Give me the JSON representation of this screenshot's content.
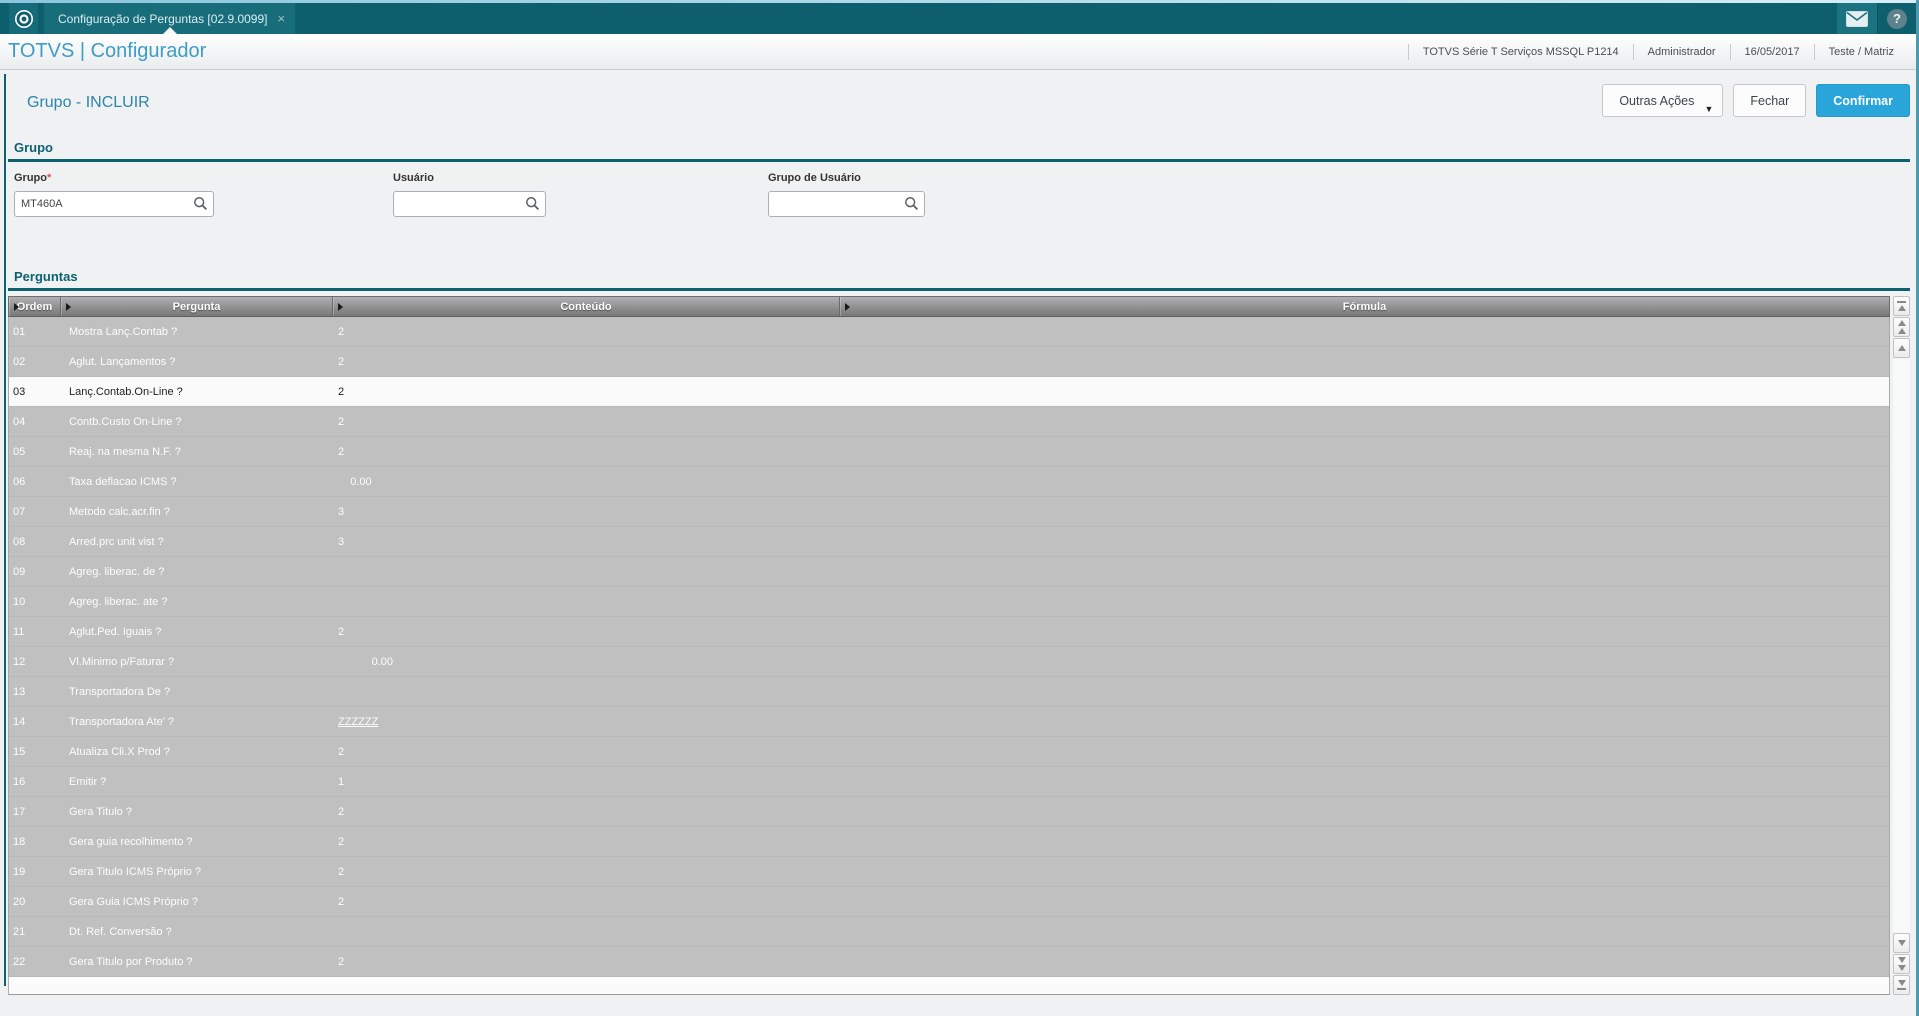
{
  "colors": {
    "accent_teal": "#0d6270",
    "titlebar_teal": "#0e5f6d",
    "tab_teal": "#176d7a",
    "confirm_blue": "#29a5da",
    "app_title_blue": "#3f9cc9",
    "page_title_blue": "#2d84ad",
    "grid_row_gray": "#c0c0c0",
    "grid_selected_row": "#fafafa"
  },
  "titlebar": {
    "tab_label": "Configuração de Perguntas [02.9.0099]",
    "close_glyph": "×",
    "help_glyph": "?"
  },
  "appbar": {
    "title": "TOTVS | Configurador",
    "info": [
      "TOTVS Série T Serviços MSSQL P1214",
      "Administrador",
      "16/05/2017",
      "Teste / Matriz"
    ]
  },
  "toolbar": {
    "page_title": "Grupo - INCLUIR",
    "other_actions_label": "Outras Ações",
    "other_actions_caret": "▼",
    "close_label": "Fechar",
    "confirm_label": "Confirmar"
  },
  "grupo": {
    "legend": "Grupo",
    "fields": [
      {
        "label": "Grupo",
        "required": "*",
        "value": "MT460A",
        "placeholder": ""
      },
      {
        "label": "Usuário",
        "required": "",
        "value": "",
        "placeholder": ""
      },
      {
        "label": "Grupo de Usuário",
        "required": "",
        "value": "",
        "placeholder": ""
      }
    ]
  },
  "perguntas": {
    "legend": "Perguntas",
    "table": {
      "columns": [
        "Ordem",
        "Pergunta",
        "Conteúdo",
        "Fórmula"
      ],
      "rows": [
        {
          "ordem": "01",
          "pergunta": "Mostra Lanç.Contab ?",
          "conteudo": "2",
          "formula": ""
        },
        {
          "ordem": "02",
          "pergunta": "Aglut. Lançamentos ?",
          "conteudo": "2",
          "formula": ""
        },
        {
          "ordem": "03",
          "pergunta": "Lanç.Contab.On-Line ?",
          "conteudo": "2",
          "formula": "",
          "selected": true
        },
        {
          "ordem": "04",
          "pergunta": "Contb.Custo On-Line ?",
          "conteudo": "2",
          "formula": ""
        },
        {
          "ordem": "05",
          "pergunta": "Reaj. na mesma N.F. ?",
          "conteudo": "2",
          "formula": ""
        },
        {
          "ordem": "06",
          "pergunta": "Taxa deflacao ICMS ?",
          "conteudo": "    0.00",
          "formula": ""
        },
        {
          "ordem": "07",
          "pergunta": "Metodo calc.acr.fin ?",
          "conteudo": "3",
          "formula": ""
        },
        {
          "ordem": "08",
          "pergunta": "Arred.prc unit vist ?",
          "conteudo": "3",
          "formula": ""
        },
        {
          "ordem": "09",
          "pergunta": "Agreg. liberac. de ?",
          "conteudo": "",
          "formula": ""
        },
        {
          "ordem": "10",
          "pergunta": "Agreg. liberac. ate ?",
          "conteudo": "",
          "formula": ""
        },
        {
          "ordem": "11",
          "pergunta": "Aglut.Ped. Iguais ?",
          "conteudo": "2",
          "formula": ""
        },
        {
          "ordem": "12",
          "pergunta": "Vl.Minimo p/Faturar ?",
          "conteudo": "           0.00",
          "formula": ""
        },
        {
          "ordem": "13",
          "pergunta": "Transportadora De ?",
          "conteudo": "",
          "formula": ""
        },
        {
          "ordem": "14",
          "pergunta": "Transportadora Ate' ?",
          "conteudo": "ZZZZZZ",
          "formula": "",
          "underline": true
        },
        {
          "ordem": "15",
          "pergunta": "Atualiza Cli.X Prod ?",
          "conteudo": "2",
          "formula": ""
        },
        {
          "ordem": "16",
          "pergunta": "Emitir ?",
          "conteudo": "1",
          "formula": ""
        },
        {
          "ordem": "17",
          "pergunta": "Gera Titulo ?",
          "conteudo": "2",
          "formula": ""
        },
        {
          "ordem": "18",
          "pergunta": "Gera guia recolhimento ?",
          "conteudo": "2",
          "formula": ""
        },
        {
          "ordem": "19",
          "pergunta": "Gera Titulo ICMS Próprio ?",
          "conteudo": "2",
          "formula": ""
        },
        {
          "ordem": "20",
          "pergunta": "Gera Guia ICMS Próprio ?",
          "conteudo": "2",
          "formula": ""
        },
        {
          "ordem": "21",
          "pergunta": "Dt. Ref. Conversão ?",
          "conteudo": "",
          "formula": ""
        },
        {
          "ordem": "22",
          "pergunta": "Gera Titulo por Produto ?",
          "conteudo": "2",
          "formula": ""
        }
      ]
    }
  }
}
